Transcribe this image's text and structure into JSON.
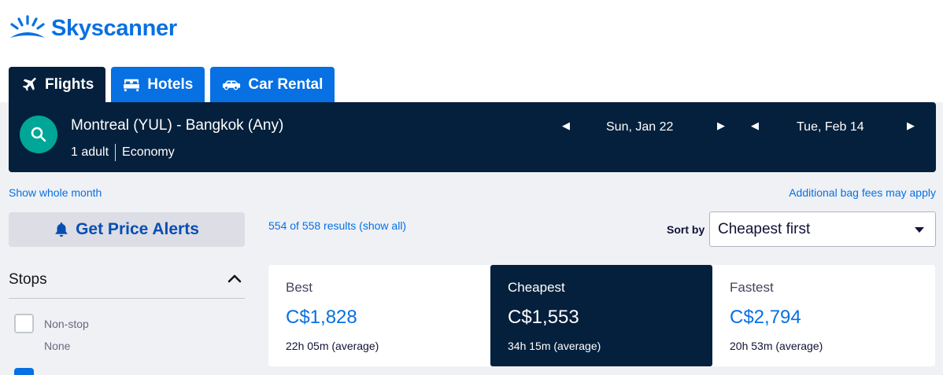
{
  "brand": {
    "name": "Skyscanner",
    "color": "#0770e3"
  },
  "tabs": [
    {
      "label": "Flights",
      "icon": "plane-icon",
      "active": true
    },
    {
      "label": "Hotels",
      "icon": "bed-icon",
      "active": false
    },
    {
      "label": "Car Rental",
      "icon": "car-icon",
      "active": false
    }
  ],
  "search": {
    "route": "Montreal (YUL) - Bangkok (Any)",
    "passengers": "1 adult",
    "cabin": "Economy",
    "depart_date": "Sun, Jan 22",
    "return_date": "Tue, Feb 14"
  },
  "links": {
    "show_month": "Show whole month",
    "bag_fees": "Additional bag fees may apply"
  },
  "price_alerts": {
    "label": "Get Price Alerts"
  },
  "results": {
    "count_text": "554 of 558 results (show all)"
  },
  "sort": {
    "label": "Sort by",
    "selected": "Cheapest first"
  },
  "filters": {
    "stops_title": "Stops",
    "nonstop_label": "Non-stop",
    "nonstop_price": "None"
  },
  "sort_tabs": [
    {
      "label": "Best",
      "price": "C$1,828",
      "duration": "22h 05m (average)",
      "active": false
    },
    {
      "label": "Cheapest",
      "price": "C$1,553",
      "duration": "34h 15m (average)",
      "active": true
    },
    {
      "label": "Fastest",
      "price": "C$2,794",
      "duration": "20h 53m (average)",
      "active": false
    }
  ]
}
